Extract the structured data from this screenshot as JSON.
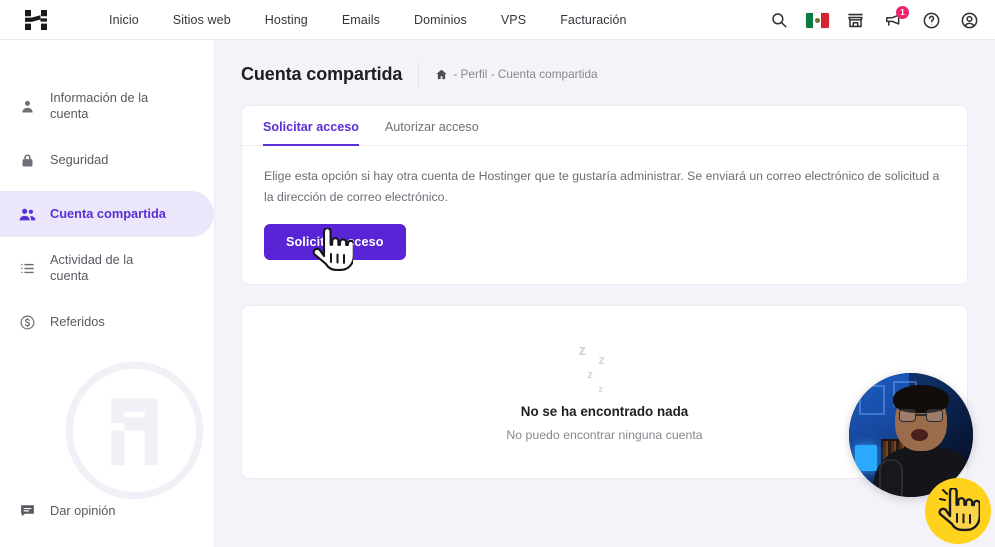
{
  "topbar": {
    "logo_icon": "hostinger-h-logo",
    "nav": [
      {
        "label": "Inicio"
      },
      {
        "label": "Sitios web"
      },
      {
        "label": "Hosting"
      },
      {
        "label": "Emails"
      },
      {
        "label": "Dominios"
      },
      {
        "label": "VPS"
      },
      {
        "label": "Facturación"
      }
    ],
    "icons": {
      "search": "search-icon",
      "flag": "mexico-flag-icon",
      "store": "store-icon",
      "notifications": "notifications-megaphone-icon",
      "notifications_badge": "1",
      "help": "help-question-icon",
      "profile": "profile-avatar-icon"
    }
  },
  "sidebar": {
    "items": [
      {
        "label": "Información de la cuenta",
        "icon": "person-icon",
        "active": false
      },
      {
        "label": "Seguridad",
        "icon": "lock-icon",
        "active": false
      },
      {
        "label": "Cuenta compartida",
        "icon": "people-icon",
        "active": true
      },
      {
        "label": "Actividad de la cuenta",
        "icon": "list-icon",
        "active": false
      },
      {
        "label": "Referidos",
        "icon": "dollar-circle-icon",
        "active": false
      }
    ],
    "feedback": {
      "label": "Dar opinión",
      "icon": "chat-feedback-icon"
    },
    "watermark_icon": "hostinger-logo-watermark"
  },
  "page": {
    "title": "Cuenta compartida",
    "breadcrumb": {
      "home_icon": "home-icon",
      "trail": "- Perfil - Cuenta compartida"
    }
  },
  "tabs": [
    {
      "label": "Solicitar acceso",
      "active": true
    },
    {
      "label": "Autorizar acceso",
      "active": false
    }
  ],
  "request_panel": {
    "description": "Elige esta opción si hay otra cuenta de Hostinger que te gustaría administrar. Se enviará un correo electrónico de solicitud a la dirección de correo electrónico.",
    "button_label": "Solicitar acceso"
  },
  "empty_state": {
    "z_glyphs": [
      "z",
      "z",
      "z",
      "z"
    ],
    "title": "No se ha encontrado nada",
    "subtitle": "No puedo encontrar ninguna cuenta"
  },
  "overlay": {
    "cursor_icon": "pointing-hand-cursor",
    "webcam_icon": "webcam-presenter-circle",
    "click_badge_icon": "pointing-hand-click-badge"
  },
  "colors": {
    "accent_purple": "#5b2fd6",
    "button_purple": "#5824d6",
    "active_pill": "#ece6fb",
    "page_bg": "#f4f3fa",
    "badge_pink": "#f0206e",
    "click_badge_yellow": "#ffd21e"
  }
}
